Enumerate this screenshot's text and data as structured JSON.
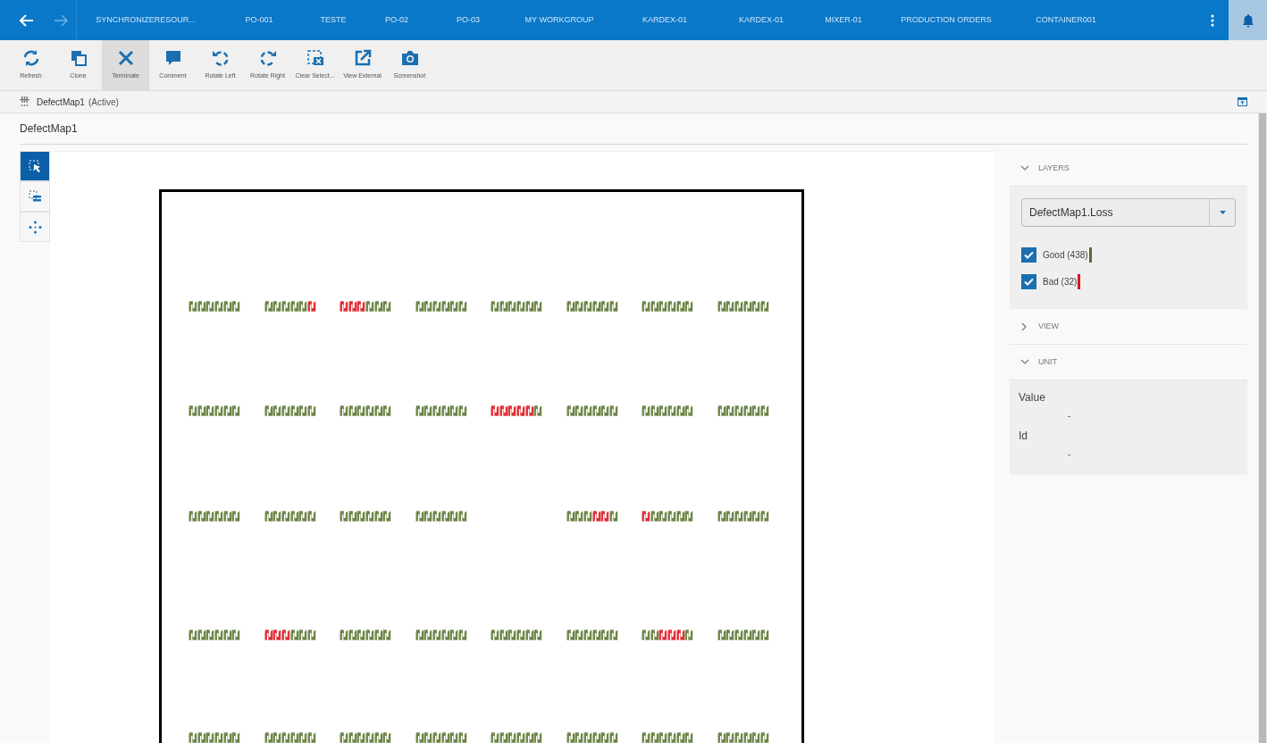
{
  "nav": {
    "tabs": [
      "SYNCHRONIZERESOUR...",
      "PO-001",
      "TESTE",
      "PO-02",
      "PO-03",
      "MY WORKGROUP",
      "KARDEX-01",
      "KARDEX-01",
      "MIXER-01",
      "PRODUCTION ORDERS",
      "CONTAINER001"
    ]
  },
  "toolbar": [
    {
      "kind": "refresh",
      "label": "Refresh",
      "selected": false
    },
    {
      "kind": "clone",
      "label": "Clone",
      "selected": false
    },
    {
      "kind": "terminate",
      "label": "Terminate",
      "selected": true
    },
    {
      "kind": "comment",
      "label": "Comment",
      "selected": false
    },
    {
      "kind": "rotate_left",
      "label": "Rotate Left",
      "selected": false
    },
    {
      "kind": "rotate_right",
      "label": "Rotate Right",
      "selected": false
    },
    {
      "kind": "clear_selection",
      "label": "Clear Select...",
      "selected": false
    },
    {
      "kind": "view_external",
      "label": "View External",
      "selected": false
    },
    {
      "kind": "screenshot",
      "label": "Screenshot",
      "selected": false
    }
  ],
  "breadcrumb": {
    "name": "DefectMap1",
    "state": "(Active)"
  },
  "page_title": "DefectMap1",
  "tools": [
    {
      "kind": "select",
      "selected": true
    },
    {
      "kind": "list_select",
      "selected": false
    },
    {
      "kind": "pan",
      "selected": false
    }
  ],
  "map": {
    "rows": [
      [
        [
          false,
          false,
          false,
          false,
          false,
          false
        ],
        [
          false,
          false,
          false,
          false,
          false,
          true
        ],
        [
          true,
          true,
          true,
          false,
          false,
          false
        ],
        [
          false,
          false,
          false,
          false,
          false,
          false
        ],
        [
          false,
          false,
          false,
          false,
          false,
          false
        ],
        [
          false,
          false,
          false,
          false,
          false,
          false
        ],
        [
          false,
          false,
          false,
          false,
          false,
          false
        ],
        [
          false,
          false,
          false,
          false,
          false,
          false
        ]
      ],
      [
        [
          false,
          false,
          false,
          false,
          false,
          false
        ],
        [
          false,
          false,
          false,
          false,
          false,
          false
        ],
        [
          false,
          false,
          false,
          false,
          false,
          false
        ],
        [
          false,
          false,
          false,
          false,
          false,
          false
        ],
        [
          true,
          true,
          true,
          true,
          true,
          false
        ],
        [
          false,
          false,
          false,
          false,
          false,
          false
        ],
        [
          false,
          false,
          false,
          false,
          false,
          false
        ],
        [
          false,
          false,
          false,
          false,
          false,
          false
        ]
      ],
      [
        [
          false,
          false,
          false,
          false,
          false,
          false
        ],
        [
          false,
          false,
          false,
          false,
          false,
          false
        ],
        [
          false,
          false,
          false,
          false,
          false,
          false
        ],
        [
          false,
          false,
          false,
          false,
          false,
          false
        ],
        null,
        [
          false,
          false,
          false,
          true,
          true,
          false
        ],
        [
          true,
          false,
          false,
          false,
          false,
          false
        ],
        [
          false,
          false,
          false,
          false,
          false,
          false
        ]
      ],
      [
        [
          false,
          false,
          false,
          false,
          false,
          false
        ],
        [
          true,
          true,
          true,
          false,
          false,
          false
        ],
        [
          false,
          false,
          false,
          false,
          false,
          false
        ],
        [
          false,
          false,
          false,
          false,
          false,
          false
        ],
        [
          false,
          false,
          false,
          false,
          false,
          false
        ],
        [
          false,
          false,
          false,
          false,
          false,
          false
        ],
        [
          false,
          false,
          true,
          true,
          true,
          false
        ],
        [
          false,
          false,
          false,
          false,
          false,
          false
        ]
      ],
      [
        [
          false,
          false,
          false,
          false,
          false,
          false
        ],
        [
          false,
          false,
          false,
          false,
          false,
          false
        ],
        [
          false,
          false,
          false,
          false,
          false,
          false
        ],
        [
          false,
          false,
          false,
          false,
          false,
          false
        ],
        [
          false,
          false,
          false,
          false,
          false,
          false
        ],
        [
          false,
          false,
          false,
          false,
          false,
          false
        ],
        [
          false,
          false,
          false,
          false,
          false,
          false
        ],
        [
          false,
          false,
          false,
          false,
          false,
          false
        ]
      ]
    ]
  },
  "panel": {
    "sections": [
      {
        "title": "LAYERS",
        "expanded": true
      },
      {
        "title": "VIEW",
        "expanded": false
      },
      {
        "title": "UNIT",
        "expanded": true
      }
    ],
    "layer_select": {
      "value": "DefectMap1.Loss"
    },
    "layers": [
      {
        "label": "Good (438)",
        "checked": true,
        "color": "#5b6b2e"
      },
      {
        "label": "Bad (32)",
        "checked": true,
        "color": "#d9141c"
      }
    ],
    "unit_fields": [
      {
        "label": "Value",
        "value": "-"
      },
      {
        "label": "Id",
        "value": "-"
      }
    ]
  }
}
